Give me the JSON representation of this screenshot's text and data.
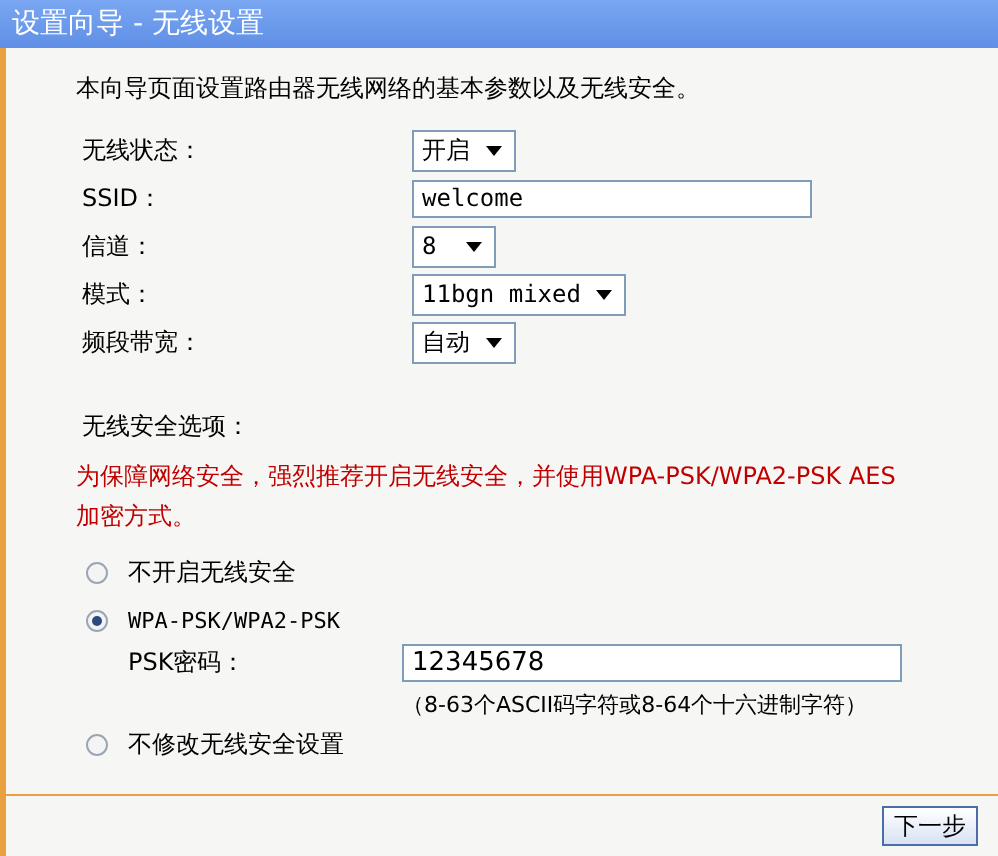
{
  "window": {
    "title": "设置向导 - 无线设置"
  },
  "intro": "本向导页面设置路由器无线网络的基本参数以及无线安全。",
  "fields": [
    {
      "label": "无线状态：",
      "kind": "select",
      "value": "开启"
    },
    {
      "label": "SSID：",
      "kind": "text",
      "value": "welcome"
    },
    {
      "label": "信道：",
      "kind": "select",
      "value": "8"
    },
    {
      "label": "模式：",
      "kind": "select",
      "value": "11bgn mixed"
    },
    {
      "label": "频段带宽：",
      "kind": "select",
      "value": "自动"
    }
  ],
  "security": {
    "title": "无线安全选项：",
    "warning": "为保障网络安全，强烈推荐开启无线安全，并使用WPA-PSK/WPA2-PSK AES加密方式。",
    "options": [
      {
        "label": "不开启无线安全",
        "selected": false
      },
      {
        "label": "WPA-PSK/WPA2-PSK",
        "selected": true,
        "psk": {
          "label": "PSK密码：",
          "value": "12345678",
          "hint": "（8-63个ASCII码字符或8-64个十六进制字符）"
        }
      },
      {
        "label": "不修改无线安全设置",
        "selected": false
      }
    ]
  },
  "buttons": [
    "下一步"
  ]
}
